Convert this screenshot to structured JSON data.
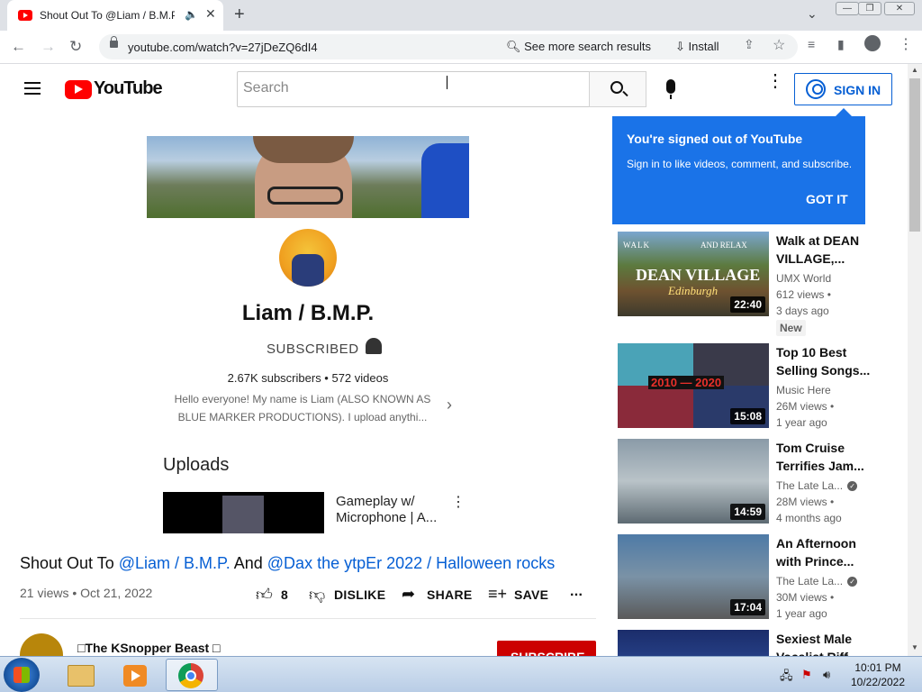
{
  "browser": {
    "tab_title": "Shout Out To @Liam / B.M.P.",
    "audio_icon": "🔈",
    "close_tab": "✕",
    "new_tab": "+",
    "tab_dropdown": "⌄",
    "url": "youtube.com/watch?v=27jDeZQ6dI4",
    "search_more": "See more search results",
    "install": "Install",
    "window_controls": [
      "minimize",
      "maximize",
      "close"
    ]
  },
  "youtube": {
    "logo_text": "YouTube",
    "search_placeholder": "Search",
    "sign_in": "SIGN IN"
  },
  "player": {
    "channel_name": "Liam / B.M.P.",
    "subscribed_label": "SUBSCRIBED",
    "stats": "2.67K subscribers • 572 videos",
    "description": "Hello everyone! My name is Liam (ALSO KNOWN AS BLUE MARKER PRODUCTIONS). I upload anythi...",
    "uploads_heading": "Uploads",
    "upload_title": "Gameplay w/ Microphone | A..."
  },
  "video": {
    "title_prefix": "Shout Out To ",
    "mention_1": "@Liam / B.M.P.",
    "title_mid": " And ",
    "mention_2": "@Dax the ytpEr 2022 / Halloween rocks",
    "meta": "21 views • Oct 21, 2022",
    "like_count": "8",
    "dislike": "DISLIKE",
    "share": "SHARE",
    "save": "SAVE",
    "more": "...",
    "owner": "□The KSnopper Beast □",
    "subscribe": "SUBSCRIBE"
  },
  "popup": {
    "title": "You're signed out of YouTube",
    "subtitle": "Sign in to like videos, comment, and subscribe.",
    "button": "GOT IT"
  },
  "recommendations": [
    {
      "title": "Walk at DEAN VILLAGE,...",
      "channel": "UMX World",
      "verified": false,
      "views": "612 views •",
      "age": "3 days ago",
      "duration": "22:40",
      "badge": "New",
      "thumb_text": [
        "WALK",
        "AND RELAX",
        "DEAN VILLAGE",
        "Edinburgh"
      ]
    },
    {
      "title": "Top 10 Best Selling Songs...",
      "channel": "Music Here",
      "verified": false,
      "views": "26M views •",
      "age": "1 year ago",
      "duration": "15:08",
      "thumb_text": [
        "2010 — 2020"
      ]
    },
    {
      "title": "Tom Cruise Terrifies Jam...",
      "channel": "The Late La...",
      "verified": true,
      "views": "28M views •",
      "age": "4 months ago",
      "duration": "14:59"
    },
    {
      "title": "An Afternoon with Prince...",
      "channel": "The Late La...",
      "verified": true,
      "views": "30M views •",
      "age": "1 year ago",
      "duration": "17:04"
    },
    {
      "title": "Sexiest Male Vocalist Riff...",
      "channel": "",
      "verified": false,
      "views": "",
      "age": "",
      "duration": ""
    }
  ],
  "taskbar": {
    "time": "10:01 PM",
    "date": "10/22/2022"
  },
  "colors": {
    "youtube_red": "#ff0000",
    "link_blue": "#065fd4",
    "popup_blue": "#1a73e8",
    "subscribe_red": "#cc0000"
  }
}
